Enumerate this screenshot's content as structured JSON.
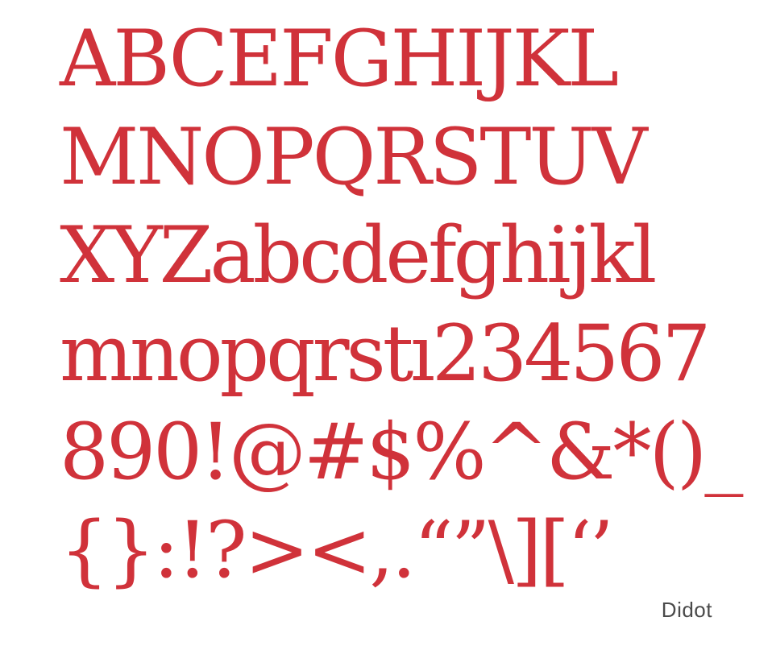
{
  "specimen": {
    "color": "#d0323a",
    "lines": [
      "ABCEFGHIJKL",
      "MNOPQRSTUV",
      "XYZabcdefghijkl",
      "mnopqrstı234567",
      "890!@#$%^&*()_",
      "{}:!?><,.“”\\][‘’"
    ]
  },
  "caption": "Didot"
}
